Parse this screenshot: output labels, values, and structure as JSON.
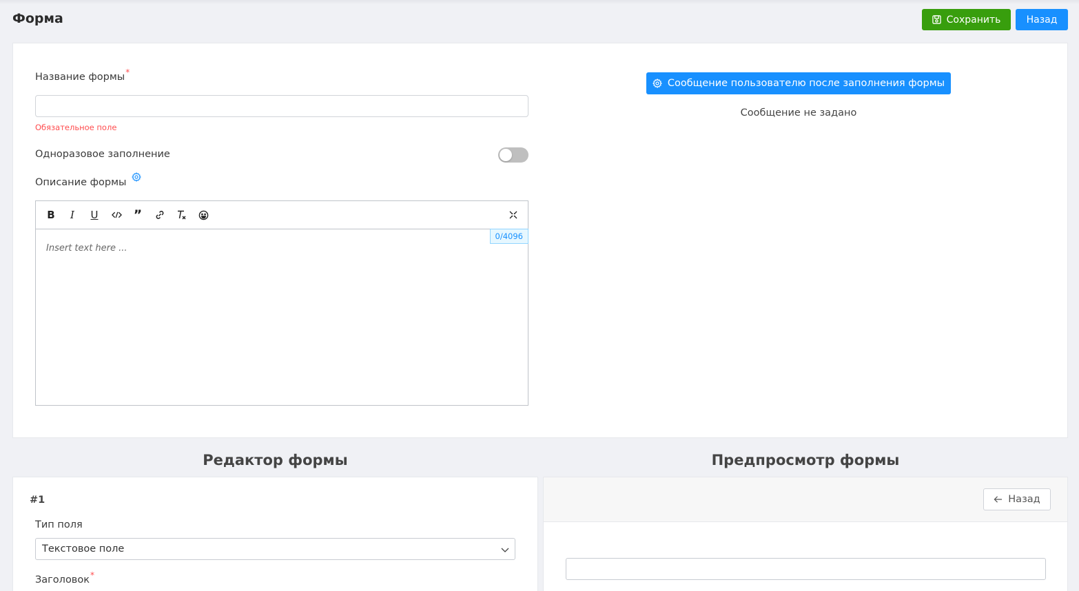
{
  "header": {
    "title": "Форма",
    "save_label": "Сохранить",
    "back_label": "Назад"
  },
  "form_settings": {
    "name_label": "Название формы",
    "name_required_mark": "*",
    "name_value": "",
    "name_error": "Обязательное поле",
    "one_time_label": "Одноразовое заполнение",
    "one_time_enabled": false,
    "description_label": "Описание формы",
    "editor": {
      "counter": "0/4096",
      "placeholder": "Insert text here ...",
      "tools": [
        "bold-icon",
        "italic-icon",
        "underline-icon",
        "code-icon",
        "quote-icon",
        "link-icon",
        "clear-format-icon",
        "emoji-icon"
      ]
    },
    "message_button_label": "Сообщение пользователю после заполнения формы",
    "message_status": "Сообщение не задано"
  },
  "editor_section": {
    "title": "Редактор формы",
    "field_number": "#1",
    "field_type_label": "Тип поля",
    "field_type_value": "Текстовое поле",
    "heading_label": "Заголовок",
    "heading_required_mark": "*"
  },
  "preview_section": {
    "title": "Предпросмотр формы",
    "back_label": "Назад"
  },
  "colors": {
    "primary": "#1890ff",
    "success": "#389e0d",
    "error": "#ff4d4f",
    "background": "#f0f1f5"
  }
}
